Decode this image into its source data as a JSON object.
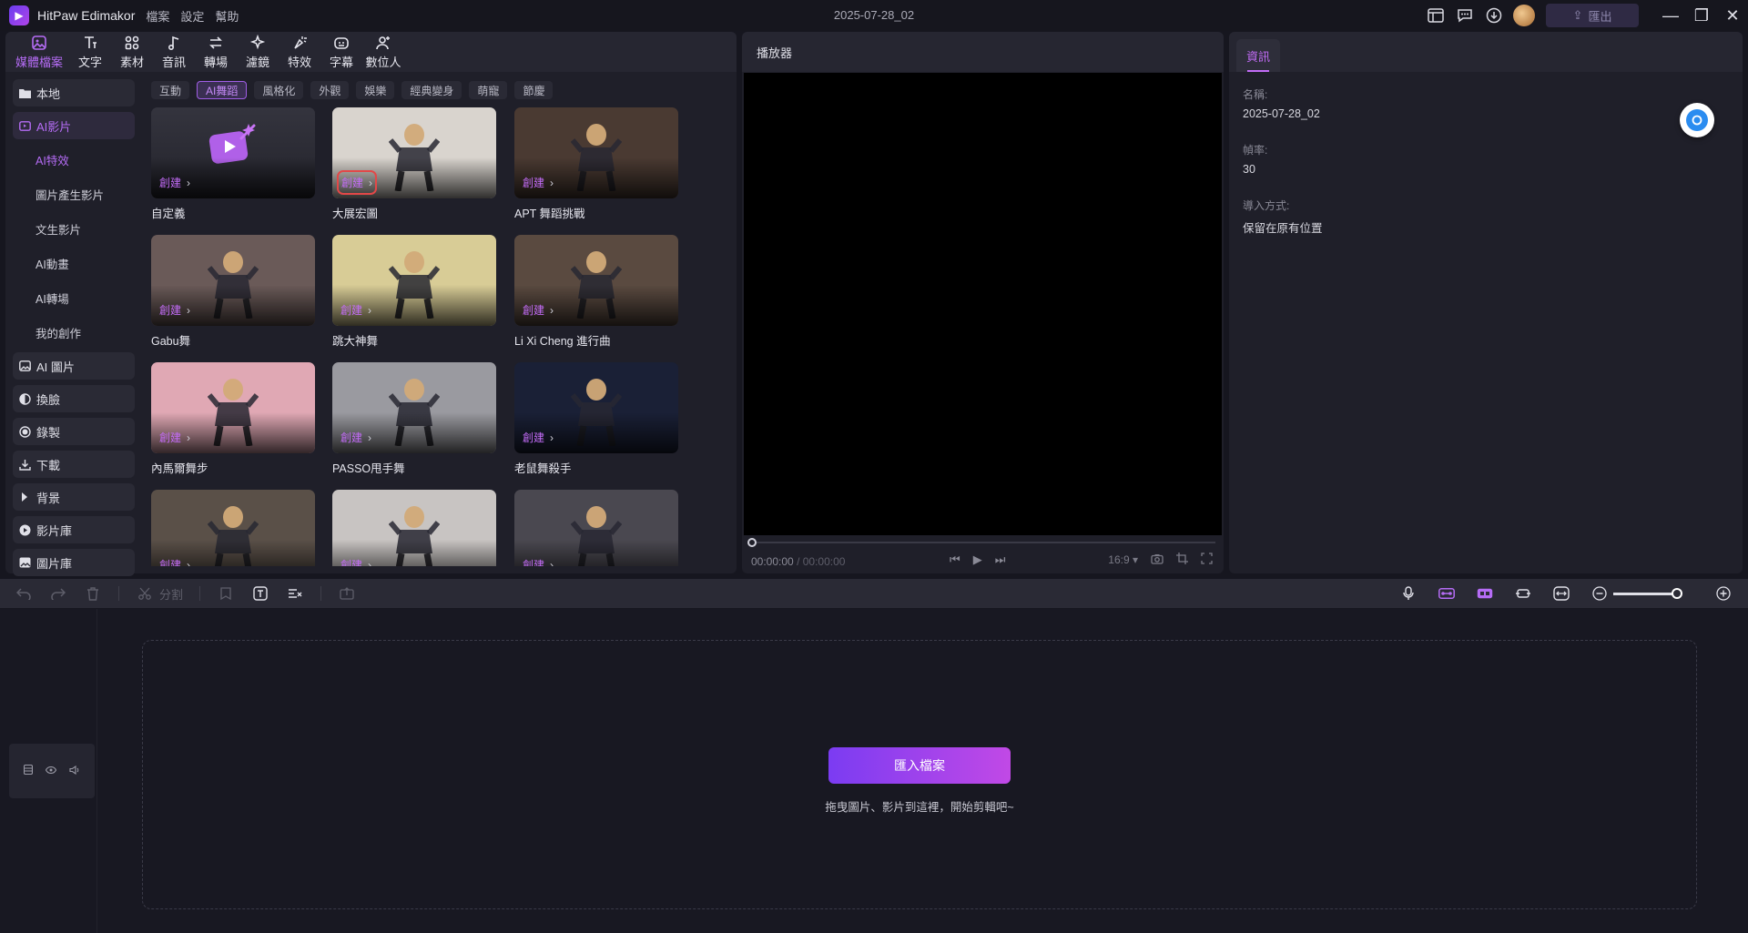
{
  "app": {
    "title": "HitPaw Edimakor",
    "menu": [
      "檔案",
      "設定",
      "幫助"
    ],
    "project_title": "2025-07-28_02",
    "export_label": "匯出"
  },
  "toolbar": {
    "tabs": [
      "媒體檔案",
      "文字",
      "素材",
      "音訊",
      "轉場",
      "濾鏡",
      "特效",
      "字幕",
      "數位人"
    ]
  },
  "sidebar": {
    "local": "本地",
    "ai_video": "AI影片",
    "subitems": [
      "AI特效",
      "圖片產生影片",
      "文生影片",
      "AI動畫",
      "AI轉場",
      "我的創作"
    ],
    "items": [
      "AI 圖片",
      "換臉",
      "錄製",
      "下載",
      "背景",
      "影片庫",
      "圖片庫"
    ]
  },
  "filters": [
    "互動",
    "AI舞蹈",
    "風格化",
    "外觀",
    "娛樂",
    "經典變身",
    "萌寵",
    "節慶"
  ],
  "grid": {
    "create_label": "創建",
    "cards": [
      {
        "label": "自定義",
        "bg": "#2b2b34"
      },
      {
        "label": "大展宏圖",
        "bg": "#d9d4ce"
      },
      {
        "label": "APT 舞蹈挑戰",
        "bg": "#4a3a32"
      },
      {
        "label": "Gabu舞",
        "bg": "#6a5a58"
      },
      {
        "label": "跳大神舞",
        "bg": "#d8cc96"
      },
      {
        "label": "Li Xi Cheng 進行曲",
        "bg": "#5a4a40"
      },
      {
        "label": "內馬爾舞步",
        "bg": "#e0a8b4"
      },
      {
        "label": "PASSO甩手舞",
        "bg": "#9a9aa0"
      },
      {
        "label": "老鼠舞殺手",
        "bg": "#1a2036"
      },
      {
        "label": "",
        "bg": "#5a5048"
      },
      {
        "label": "",
        "bg": "#c8c4c2"
      },
      {
        "label": "",
        "bg": "#4a4850"
      }
    ]
  },
  "player": {
    "title": "播放器",
    "time_current": "00:00:00",
    "time_total": "/ 00:00:00",
    "aspect": "16:9"
  },
  "info": {
    "tab": "資訊",
    "name_label": "名稱:",
    "name_value": "2025-07-28_02",
    "fps_label": "幀率:",
    "fps_value": "30",
    "import_label": "導入方式:",
    "import_value": "保留在原有位置"
  },
  "edit_toolbar": {
    "split_label": "分割"
  },
  "timeline": {
    "import_button": "匯入檔案",
    "drop_hint": "拖曳圖片、影片到這裡，開始剪輯吧~"
  },
  "colors": {
    "accent": "#b56cf5",
    "highlight": "#e24848"
  }
}
